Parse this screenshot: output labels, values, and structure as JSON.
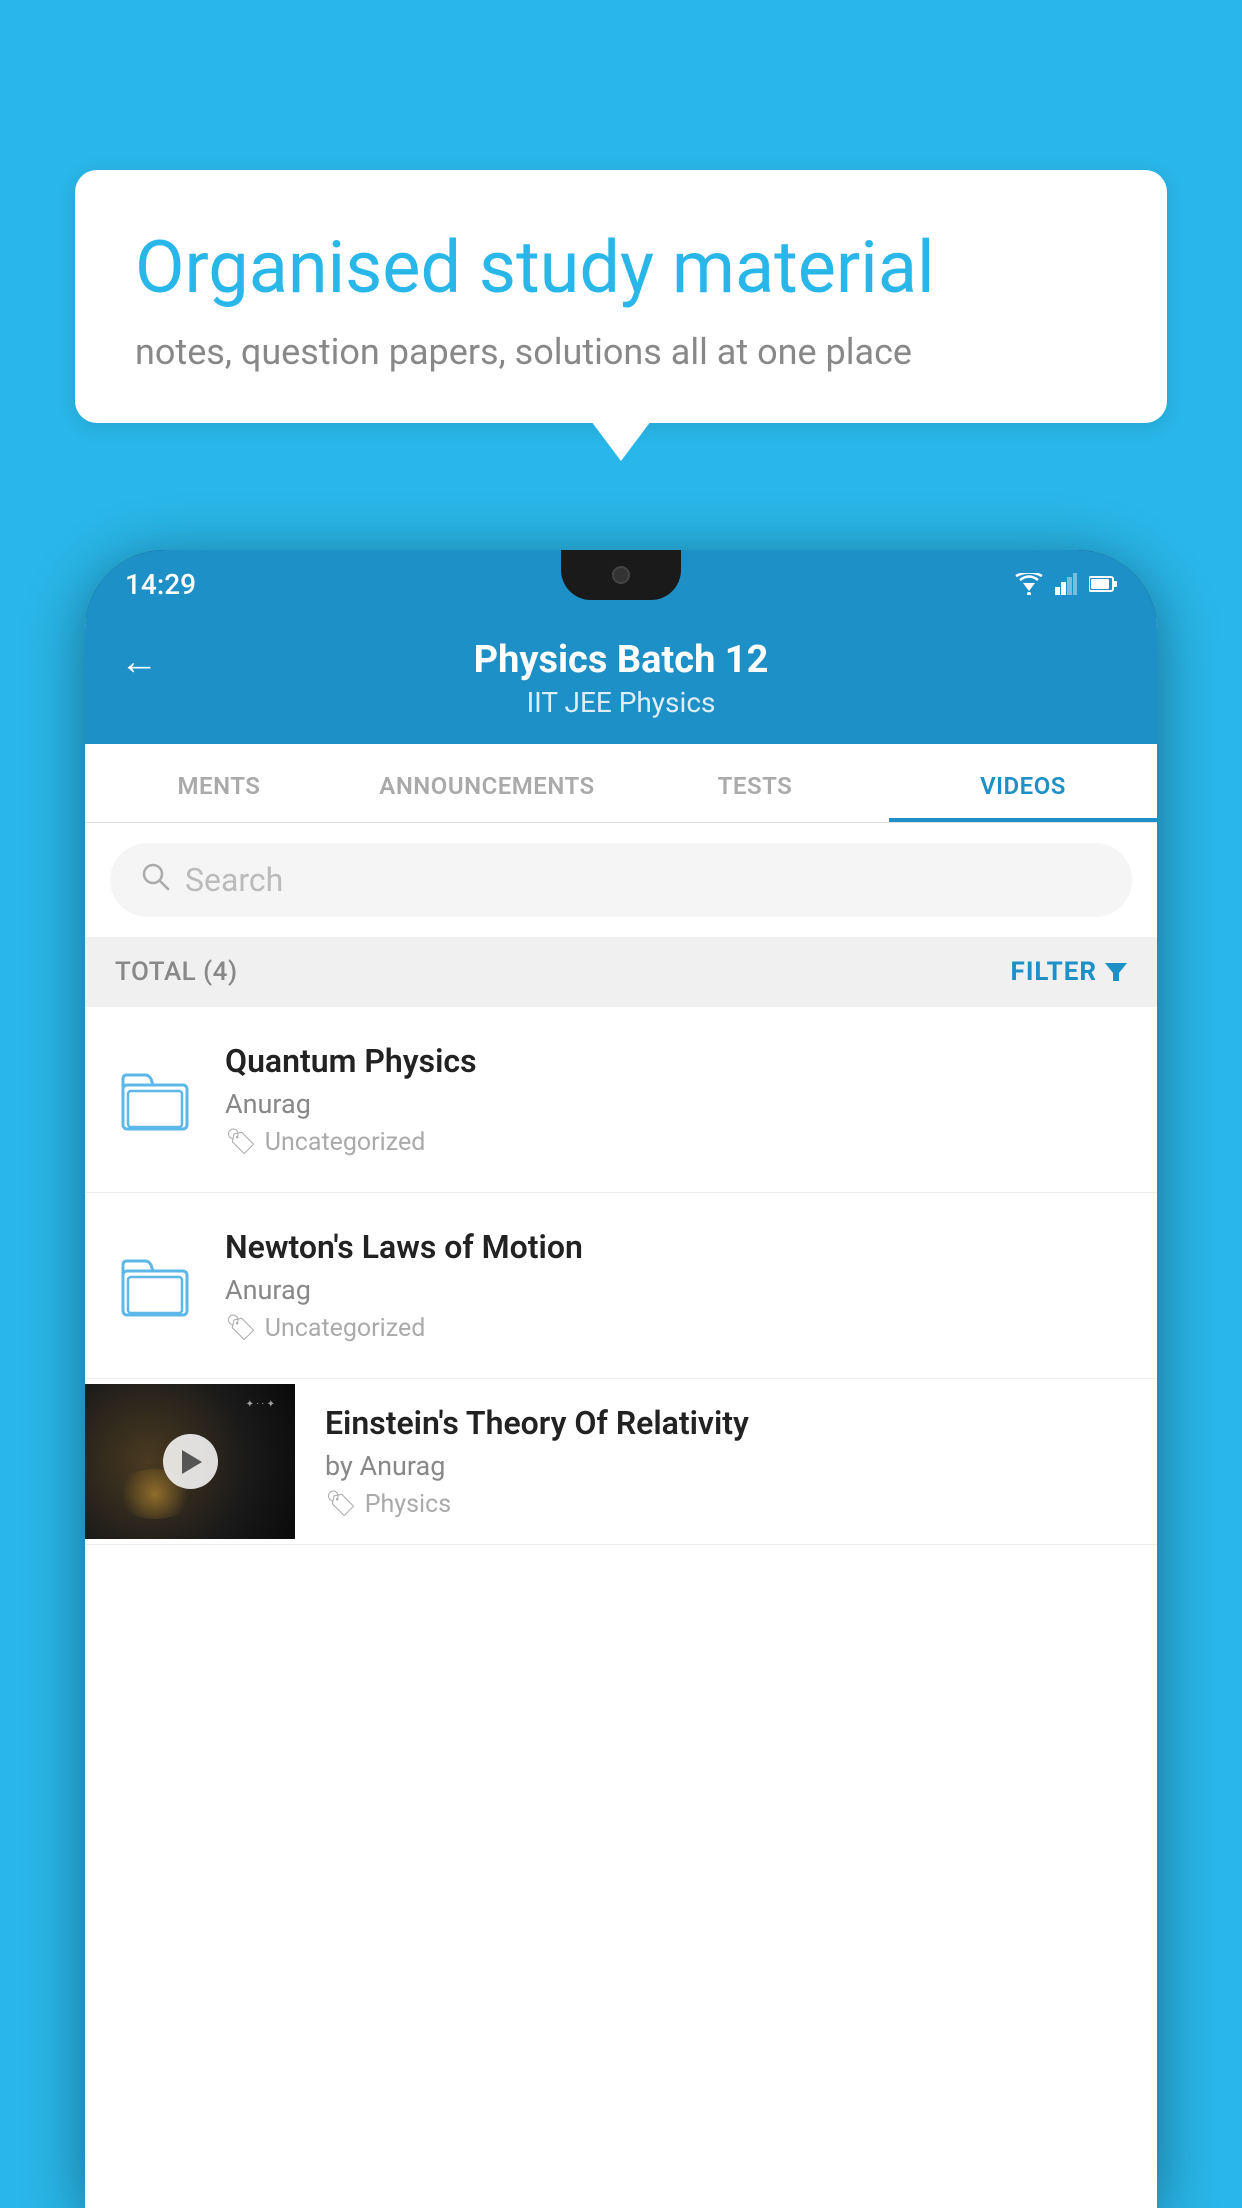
{
  "hero": {
    "title": "Organised study material",
    "subtitle": "notes, question papers, solutions all at one place"
  },
  "status_bar": {
    "time": "14:29"
  },
  "header": {
    "title": "Physics Batch 12",
    "subtitle": "IIT JEE   Physics",
    "back_label": "←"
  },
  "tabs": [
    {
      "label": "MENTS",
      "active": false
    },
    {
      "label": "ANNOUNCEMENTS",
      "active": false
    },
    {
      "label": "TESTS",
      "active": false
    },
    {
      "label": "VIDEOS",
      "active": true
    }
  ],
  "search": {
    "placeholder": "Search"
  },
  "filter_bar": {
    "total_label": "TOTAL (4)",
    "filter_label": "FILTER"
  },
  "items": [
    {
      "title": "Quantum Physics",
      "author": "Anurag",
      "tag": "Uncategorized",
      "type": "folder"
    },
    {
      "title": "Newton's Laws of Motion",
      "author": "Anurag",
      "tag": "Uncategorized",
      "type": "folder"
    },
    {
      "title": "Einstein's Theory Of Relativity",
      "author": "by Anurag",
      "tag": "Physics",
      "type": "video"
    }
  ]
}
